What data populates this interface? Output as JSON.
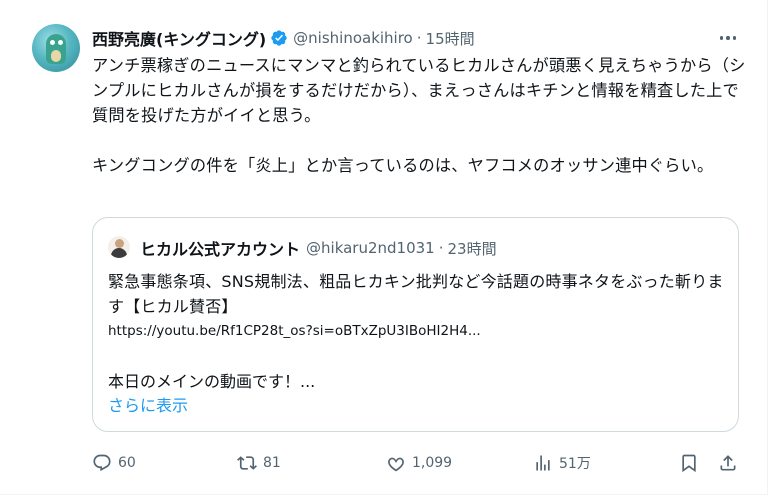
{
  "tweet": {
    "author_name": "西野亮廣(キングコング)",
    "handle": "@nishinoakihiro",
    "separator": "·",
    "time": "15時間",
    "verified_color": "#1d9bf0",
    "text": "アンチ票稼ぎのニュースにマンマと釣られているヒカルさんが頭悪く見えちゃうから（シンプルにヒカルさんが損をするだけだから）、まえっさんはキチンと情報を精査した上で質問を投げた方がイイと思う。\n\nキングコングの件を「炎上」とか言っているのは、ヤフコメのオッサン連中ぐらい。"
  },
  "quote": {
    "author_name": "ヒカル公式アカウント",
    "handle": "@hikaru2nd1031",
    "separator": "·",
    "time": "23時間",
    "text": "緊急事態条項、SNS規制法、粗品ヒカキン批判など今話題の時事ネタをぶった斬ります【ヒカル賛否】",
    "url": "https://youtu.be/Rf1CP28t_os?si=oBTxZpU3IBoHI2H4...",
    "main_text": "本日のメインの動画です！...",
    "show_more": "さらに表示"
  },
  "actions": {
    "reply": {
      "icon": "reply-icon",
      "count": "60"
    },
    "retweet": {
      "icon": "retweet-icon",
      "count": "81"
    },
    "like": {
      "icon": "like-icon",
      "count": "1,099"
    },
    "views": {
      "icon": "views-icon",
      "count": "51万"
    },
    "bookmark": {
      "icon": "bookmark-icon"
    },
    "share": {
      "icon": "share-icon"
    }
  },
  "colors": {
    "text": "#0f1419",
    "secondary": "#536471",
    "link": "#1d9bf0",
    "border": "#cfd9de"
  }
}
